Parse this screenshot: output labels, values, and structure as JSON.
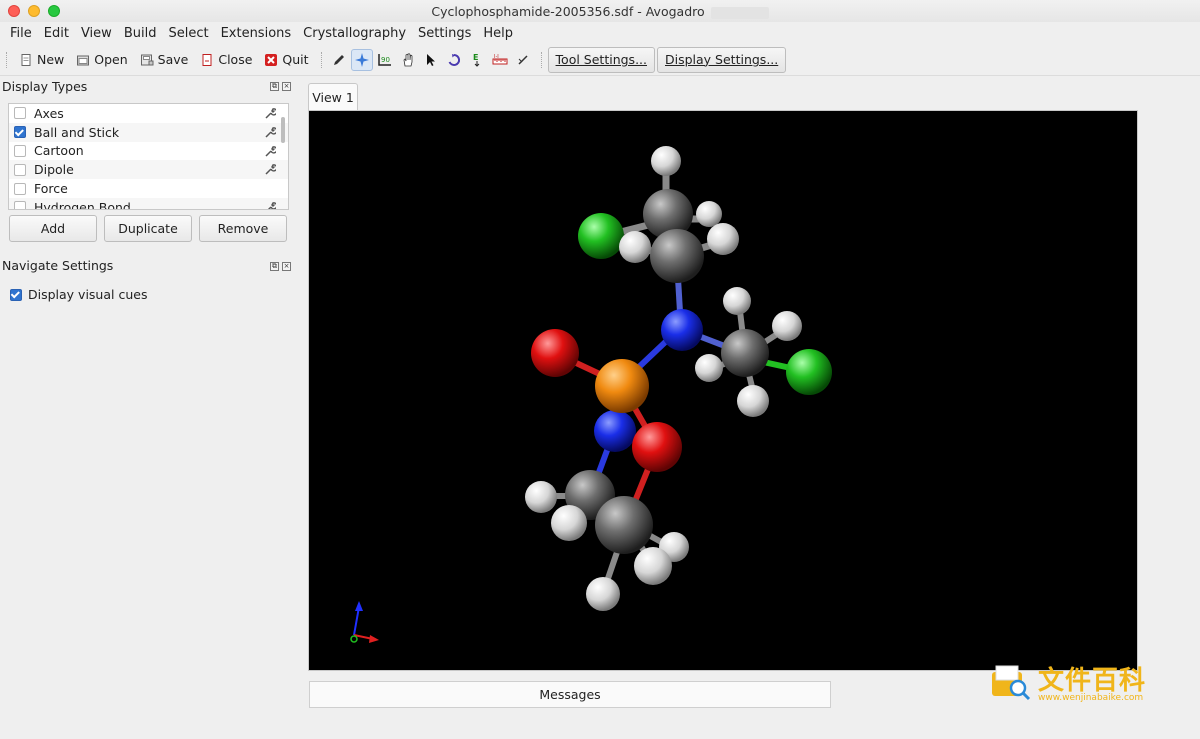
{
  "window": {
    "title": "Cyclophosphamide-2005356.sdf - Avogadro"
  },
  "menu": [
    "File",
    "Edit",
    "View",
    "Build",
    "Select",
    "Extensions",
    "Crystallography",
    "Settings",
    "Help"
  ],
  "toolbar": {
    "new_label": "New",
    "open_label": "Open",
    "save_label": "Save",
    "close_label": "Close",
    "quit_label": "Quit",
    "tool_settings_label": "Tool Settings...",
    "display_settings_label": "Display Settings...",
    "tools": [
      "draw-tool-icon",
      "navigate-tool-icon",
      "bond-centric-manipulate-icon",
      "manipulate-hand-icon",
      "selection-arrow-icon",
      "auto-rotate-icon",
      "auto-optimize-icon",
      "measure-icon",
      "align-icon"
    ]
  },
  "display_types": {
    "title": "Display Types",
    "items": [
      {
        "label": "Axes",
        "checked": false
      },
      {
        "label": "Ball and Stick",
        "checked": true
      },
      {
        "label": "Cartoon",
        "checked": false
      },
      {
        "label": "Dipole",
        "checked": false
      },
      {
        "label": "Force",
        "checked": false
      },
      {
        "label": "Hydrogen Bond",
        "checked": false
      }
    ],
    "add_label": "Add",
    "duplicate_label": "Duplicate",
    "remove_label": "Remove"
  },
  "navigate_settings": {
    "title": "Navigate Settings",
    "display_visual_cues_label": "Display visual cues",
    "display_visual_cues_checked": true
  },
  "view": {
    "tab_label": "View 1"
  },
  "messages": {
    "label": "Messages"
  },
  "watermark": {
    "text": "文件百科",
    "url": "www.wenjinabaike.com"
  },
  "colors": {
    "viewport_bg": "#000000",
    "carbon": "#5a5a5a",
    "hydrogen": "#e8e8e8",
    "nitrogen": "#1a2ee8",
    "oxygen": "#e01010",
    "phosphorus": "#f08a10",
    "chlorine": "#22c022",
    "checkbox_accent": "#2f74d0"
  }
}
